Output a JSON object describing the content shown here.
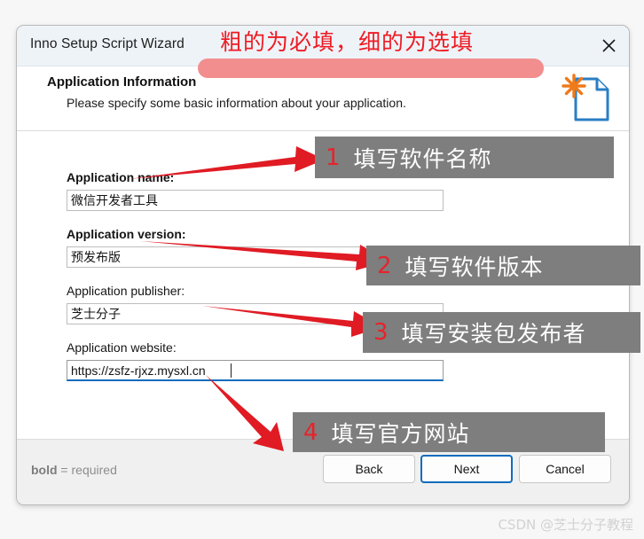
{
  "window": {
    "title": "Inno Setup Script Wizard",
    "close_icon": "close-icon"
  },
  "header": {
    "heading": "Application Information",
    "subheading": "Please specify some basic information about your application.",
    "icon": "document-star-icon"
  },
  "form": {
    "fields": [
      {
        "label": "Application name:",
        "required": true,
        "value": "微信开发者工具",
        "focused": false
      },
      {
        "label": "Application version:",
        "required": true,
        "value": "预发布版",
        "focused": false
      },
      {
        "label": "Application publisher:",
        "required": false,
        "value": "芝士分子",
        "focused": false
      },
      {
        "label": "Application website:",
        "required": false,
        "value": "https://zsfz-rjxz.mysxl.cn",
        "focused": true
      }
    ]
  },
  "footer": {
    "required_note_bold": "bold",
    "required_note_rest": " = required",
    "buttons": {
      "back": "Back",
      "next": "Next",
      "cancel": "Cancel"
    }
  },
  "annotations": {
    "top_note": "粗的为必填，细的为选填",
    "callouts": [
      {
        "number": "1",
        "text": "填写软件名称"
      },
      {
        "number": "2",
        "text": "填写软件版本"
      },
      {
        "number": "3",
        "text": "填写安装包发布者"
      },
      {
        "number": "4",
        "text": "填写官方网站"
      }
    ],
    "colors": {
      "arrow_red": "#e01b24",
      "callout_gray": "#7e7e7e",
      "number_red": "#e8222a",
      "pill_pink": "#f28e8e",
      "accent_blue": "#0f6cbd"
    }
  },
  "watermark": {
    "text": "CSDN @芝士分子教程"
  }
}
